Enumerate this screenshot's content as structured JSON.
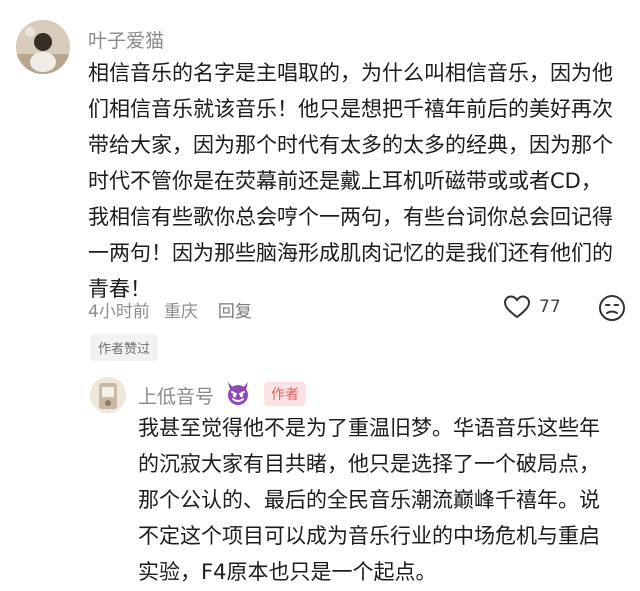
{
  "comment": {
    "username": "叶子爱猫",
    "lines": [
      "相信音乐的名字是主唱取的，为什么叫相信音乐，因为他",
      "们相信音乐就该音乐！他只是想把千禧年前后的美好再次",
      "带给大家，因为那个时代有太多的太多的经典，因为那个",
      "时代不管你是在荧幕前还是戴上耳机听磁带或或者CD，",
      "我相信有些歌你总会哼个一两句，有些台词你总会回记得",
      "一两句！因为那些脑海形成肌肉记忆的是我们还有他们的",
      "青春！"
    ],
    "time": "4小时前",
    "location": "重庆",
    "reply_label": "回复",
    "like_count": "77",
    "author_liked": "作者赞过",
    "icons": {
      "like": "heart-icon",
      "dislike": "frown-face-icon"
    }
  },
  "reply": {
    "username": "上低音号",
    "author_badge": "作者",
    "lines": [
      "我甚至觉得他不是为了重温旧梦。华语音乐这些年",
      "的沉寂大家有目共睹，他只是选择了一个破局点，",
      "那个公认的、最后的全民音乐潮流巅峰千禧年。说",
      "不定这个项目可以成为音乐行业的中场危机与重启",
      "实验，F4原本也只是一个起点。"
    ],
    "icons": {
      "emoji": "purple-devil-icon"
    }
  },
  "colors": {
    "badge_bg": "#fbe3e3",
    "badge_text": "#e0605a",
    "devil": "#7b3fa0"
  }
}
